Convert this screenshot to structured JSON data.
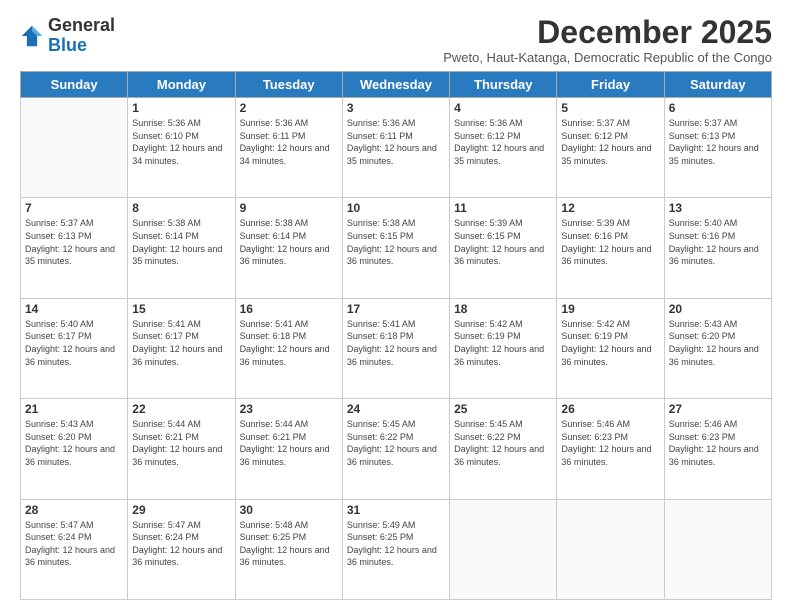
{
  "header": {
    "logo_general": "General",
    "logo_blue": "Blue",
    "month_year": "December 2025",
    "subtitle": "Pweto, Haut-Katanga, Democratic Republic of the Congo"
  },
  "days_of_week": [
    "Sunday",
    "Monday",
    "Tuesday",
    "Wednesday",
    "Thursday",
    "Friday",
    "Saturday"
  ],
  "weeks": [
    [
      {
        "day": "",
        "info": ""
      },
      {
        "day": "1",
        "info": "Sunrise: 5:36 AM\nSunset: 6:10 PM\nDaylight: 12 hours and 34 minutes."
      },
      {
        "day": "2",
        "info": "Sunrise: 5:36 AM\nSunset: 6:11 PM\nDaylight: 12 hours and 34 minutes."
      },
      {
        "day": "3",
        "info": "Sunrise: 5:36 AM\nSunset: 6:11 PM\nDaylight: 12 hours and 35 minutes."
      },
      {
        "day": "4",
        "info": "Sunrise: 5:36 AM\nSunset: 6:12 PM\nDaylight: 12 hours and 35 minutes."
      },
      {
        "day": "5",
        "info": "Sunrise: 5:37 AM\nSunset: 6:12 PM\nDaylight: 12 hours and 35 minutes."
      },
      {
        "day": "6",
        "info": "Sunrise: 5:37 AM\nSunset: 6:13 PM\nDaylight: 12 hours and 35 minutes."
      }
    ],
    [
      {
        "day": "7",
        "info": "Sunrise: 5:37 AM\nSunset: 6:13 PM\nDaylight: 12 hours and 35 minutes."
      },
      {
        "day": "8",
        "info": "Sunrise: 5:38 AM\nSunset: 6:14 PM\nDaylight: 12 hours and 35 minutes."
      },
      {
        "day": "9",
        "info": "Sunrise: 5:38 AM\nSunset: 6:14 PM\nDaylight: 12 hours and 36 minutes."
      },
      {
        "day": "10",
        "info": "Sunrise: 5:38 AM\nSunset: 6:15 PM\nDaylight: 12 hours and 36 minutes."
      },
      {
        "day": "11",
        "info": "Sunrise: 5:39 AM\nSunset: 6:15 PM\nDaylight: 12 hours and 36 minutes."
      },
      {
        "day": "12",
        "info": "Sunrise: 5:39 AM\nSunset: 6:16 PM\nDaylight: 12 hours and 36 minutes."
      },
      {
        "day": "13",
        "info": "Sunrise: 5:40 AM\nSunset: 6:16 PM\nDaylight: 12 hours and 36 minutes."
      }
    ],
    [
      {
        "day": "14",
        "info": "Sunrise: 5:40 AM\nSunset: 6:17 PM\nDaylight: 12 hours and 36 minutes."
      },
      {
        "day": "15",
        "info": "Sunrise: 5:41 AM\nSunset: 6:17 PM\nDaylight: 12 hours and 36 minutes."
      },
      {
        "day": "16",
        "info": "Sunrise: 5:41 AM\nSunset: 6:18 PM\nDaylight: 12 hours and 36 minutes."
      },
      {
        "day": "17",
        "info": "Sunrise: 5:41 AM\nSunset: 6:18 PM\nDaylight: 12 hours and 36 minutes."
      },
      {
        "day": "18",
        "info": "Sunrise: 5:42 AM\nSunset: 6:19 PM\nDaylight: 12 hours and 36 minutes."
      },
      {
        "day": "19",
        "info": "Sunrise: 5:42 AM\nSunset: 6:19 PM\nDaylight: 12 hours and 36 minutes."
      },
      {
        "day": "20",
        "info": "Sunrise: 5:43 AM\nSunset: 6:20 PM\nDaylight: 12 hours and 36 minutes."
      }
    ],
    [
      {
        "day": "21",
        "info": "Sunrise: 5:43 AM\nSunset: 6:20 PM\nDaylight: 12 hours and 36 minutes."
      },
      {
        "day": "22",
        "info": "Sunrise: 5:44 AM\nSunset: 6:21 PM\nDaylight: 12 hours and 36 minutes."
      },
      {
        "day": "23",
        "info": "Sunrise: 5:44 AM\nSunset: 6:21 PM\nDaylight: 12 hours and 36 minutes."
      },
      {
        "day": "24",
        "info": "Sunrise: 5:45 AM\nSunset: 6:22 PM\nDaylight: 12 hours and 36 minutes."
      },
      {
        "day": "25",
        "info": "Sunrise: 5:45 AM\nSunset: 6:22 PM\nDaylight: 12 hours and 36 minutes."
      },
      {
        "day": "26",
        "info": "Sunrise: 5:46 AM\nSunset: 6:23 PM\nDaylight: 12 hours and 36 minutes."
      },
      {
        "day": "27",
        "info": "Sunrise: 5:46 AM\nSunset: 6:23 PM\nDaylight: 12 hours and 36 minutes."
      }
    ],
    [
      {
        "day": "28",
        "info": "Sunrise: 5:47 AM\nSunset: 6:24 PM\nDaylight: 12 hours and 36 minutes."
      },
      {
        "day": "29",
        "info": "Sunrise: 5:47 AM\nSunset: 6:24 PM\nDaylight: 12 hours and 36 minutes."
      },
      {
        "day": "30",
        "info": "Sunrise: 5:48 AM\nSunset: 6:25 PM\nDaylight: 12 hours and 36 minutes."
      },
      {
        "day": "31",
        "info": "Sunrise: 5:49 AM\nSunset: 6:25 PM\nDaylight: 12 hours and 36 minutes."
      },
      {
        "day": "",
        "info": ""
      },
      {
        "day": "",
        "info": ""
      },
      {
        "day": "",
        "info": ""
      }
    ]
  ]
}
